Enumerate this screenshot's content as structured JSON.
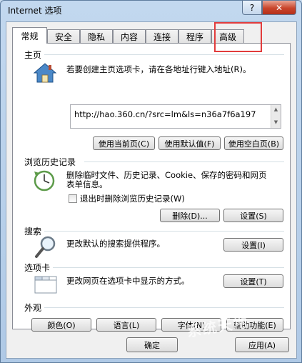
{
  "window": {
    "title": "Internet 选项",
    "help": "?",
    "close": "✕"
  },
  "tabs": [
    {
      "label": "常规"
    },
    {
      "label": "安全"
    },
    {
      "label": "隐私"
    },
    {
      "label": "内容"
    },
    {
      "label": "连接"
    },
    {
      "label": "程序"
    },
    {
      "label": "高级"
    }
  ],
  "home": {
    "section": "主页",
    "description": "若要创建主页选项卡，请在各地址行键入地址(R)。",
    "url": "http://hao.360.cn/?src=lm&ls=n36a7f6a197",
    "btn_current": "使用当前页(C)",
    "btn_default": "使用默认值(F)",
    "btn_blank": "使用空白页(B)"
  },
  "history": {
    "section": "浏览历史记录",
    "description_line1": "删除临时文件、历史记录、Cookie、保存的密码和网页",
    "description_line2": "表单信息。",
    "checkbox": "退出时删除浏览历史记录(W)",
    "btn_delete": "删除(D)...",
    "btn_settings": "设置(S)"
  },
  "search": {
    "section": "搜索",
    "description": "更改默认的搜索提供程序。",
    "btn_settings": "设置(I)"
  },
  "tabs_section": {
    "section": "选项卡",
    "description": "更改网页在选项卡中显示的方式。",
    "btn_settings": "设置(T)"
  },
  "appearance": {
    "section": "外观",
    "btn_colors": "颜色(O)",
    "btn_languages": "语言(L)",
    "btn_fonts": "字体(N)",
    "btn_accessibility": "辅助功能(E)"
  },
  "footer": {
    "btn_ok": "确定",
    "btn_apply": "应用(A)"
  },
  "watermark": "系统天地"
}
